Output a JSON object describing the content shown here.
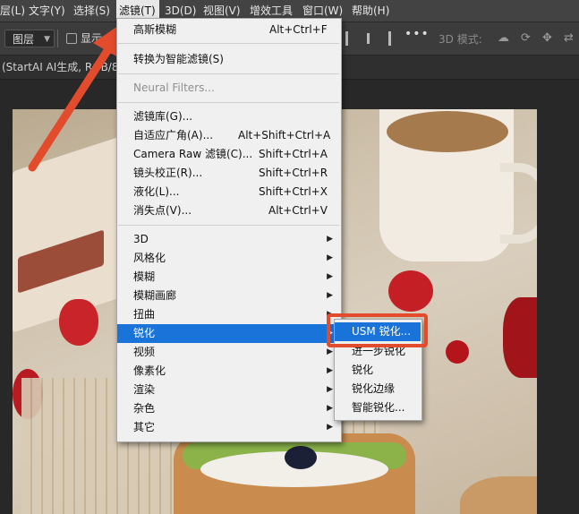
{
  "menubar": {
    "items": [
      "层(L)",
      "文字(Y)",
      "选择(S)",
      "滤镜(T)",
      "3D(D)",
      "视图(V)",
      "增效工具",
      "窗口(W)",
      "帮助(H)"
    ],
    "active_index": 3
  },
  "options": {
    "layer_select": "图层",
    "show_label": "显示",
    "more": "•••",
    "mode_3d": "3D 模式:"
  },
  "document_tab": "(StartAI AI生成, RGB/8#)",
  "filter_menu": {
    "items": [
      {
        "label": "高斯模糊",
        "shortcut": "Alt+Ctrl+F"
      },
      {
        "label": "转换为智能滤镜(S)"
      },
      {
        "label": "Neural Filters...",
        "disabled": true
      },
      {
        "label": "滤镜库(G)..."
      },
      {
        "label": "自适应广角(A)...",
        "shortcut": "Alt+Shift+Ctrl+A"
      },
      {
        "label": "Camera Raw 滤镜(C)...",
        "shortcut": "Shift+Ctrl+A"
      },
      {
        "label": "镜头校正(R)...",
        "shortcut": "Shift+Ctrl+R"
      },
      {
        "label": "液化(L)...",
        "shortcut": "Shift+Ctrl+X"
      },
      {
        "label": "消失点(V)...",
        "shortcut": "Alt+Ctrl+V"
      },
      {
        "label": "3D",
        "submenu": true
      },
      {
        "label": "风格化",
        "submenu": true
      },
      {
        "label": "模糊",
        "submenu": true
      },
      {
        "label": "模糊画廊",
        "submenu": true
      },
      {
        "label": "扭曲",
        "submenu": true
      },
      {
        "label": "锐化",
        "submenu": true,
        "highlighted": true
      },
      {
        "label": "视频",
        "submenu": true
      },
      {
        "label": "像素化",
        "submenu": true
      },
      {
        "label": "渲染",
        "submenu": true
      },
      {
        "label": "杂色",
        "submenu": true
      },
      {
        "label": "其它",
        "submenu": true
      }
    ]
  },
  "sharpen_submenu": {
    "items": [
      {
        "label": "USM 锐化...",
        "highlighted": true
      },
      {
        "label": "进一步锐化"
      },
      {
        "label": "锐化"
      },
      {
        "label": "锐化边缘"
      },
      {
        "label": "智能锐化..."
      }
    ]
  },
  "colors": {
    "highlight": "#1a73d9",
    "callout": "#e24c2d"
  }
}
